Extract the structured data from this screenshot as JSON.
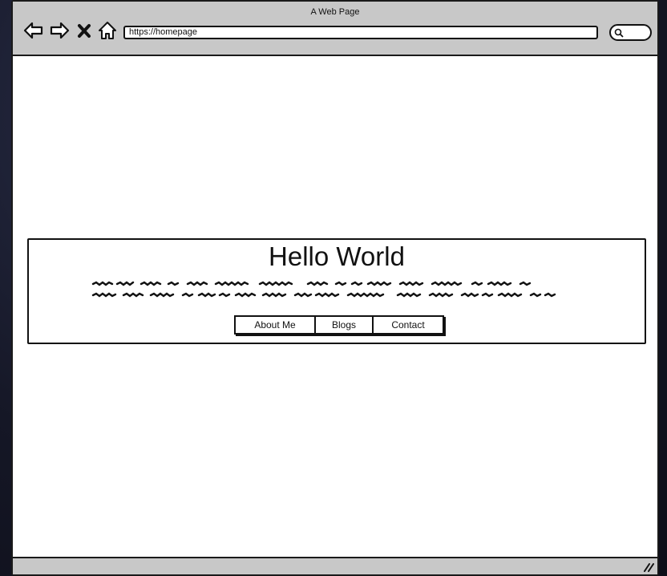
{
  "window": {
    "title": "A Web Page"
  },
  "toolbar": {
    "back_icon": "back-arrow-icon",
    "forward_icon": "forward-arrow-icon",
    "stop_icon": "close-icon",
    "home_icon": "home-icon",
    "search_icon": "search-icon"
  },
  "address_bar": {
    "url": "https://homepage"
  },
  "hero": {
    "title": "Hello World",
    "body_lines": 2,
    "buttons": [
      {
        "label": "About Me"
      },
      {
        "label": "Blogs"
      },
      {
        "label": "Contact"
      }
    ]
  },
  "colors": {
    "chrome": "#c8c8c8",
    "ink": "#111111",
    "page": "#ffffff"
  }
}
